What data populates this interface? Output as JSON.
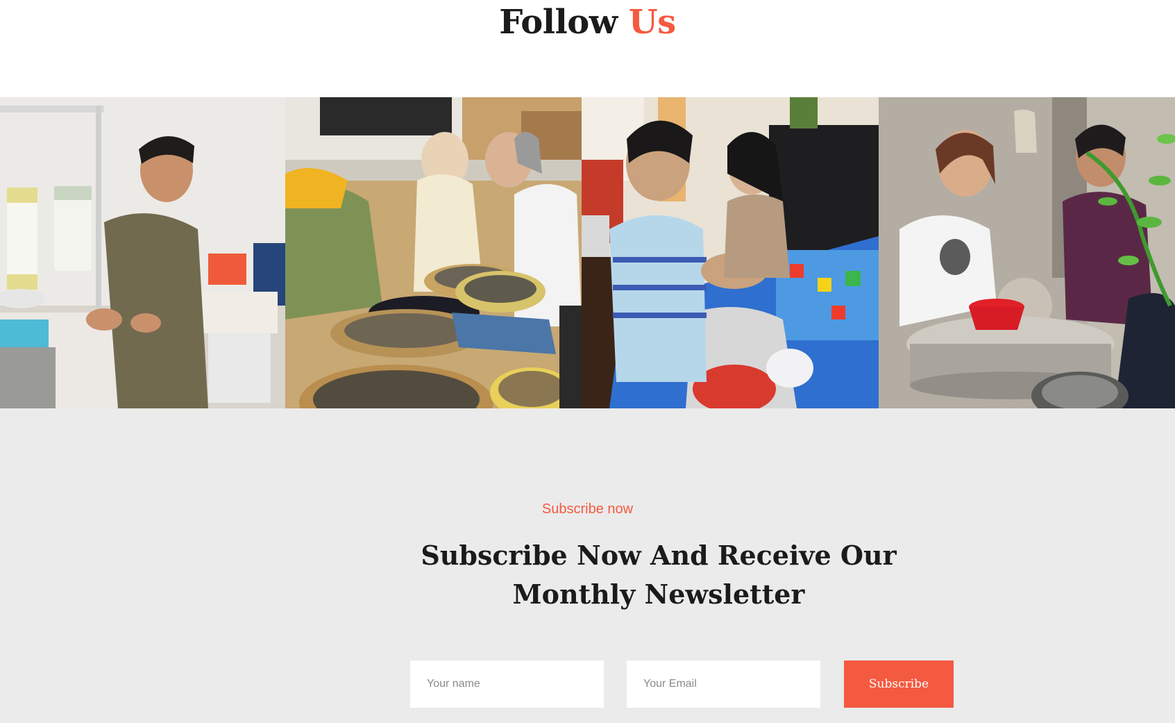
{
  "follow": {
    "title_main": "Follow",
    "title_accent": "Us"
  },
  "gallery": {
    "photos": [
      {
        "subject": "man operating a thread winding machine"
      },
      {
        "subject": "two people sorting dried herbs in woven baskets"
      },
      {
        "subject": "young man and woman assembling small colorful items at a table"
      },
      {
        "subject": "woman and man crafting at a round stone table"
      }
    ]
  },
  "subscribe": {
    "kicker": "Subscribe now",
    "headline": "Subscribe Now And Receive Our Monthly Newsletter",
    "name_placeholder": "Your name",
    "email_placeholder": "Your Email",
    "button_label": "Subscribe"
  },
  "colors": {
    "accent": "#f45a40",
    "section_bg": "#ebebeb",
    "heading": "#1b1b1b"
  }
}
